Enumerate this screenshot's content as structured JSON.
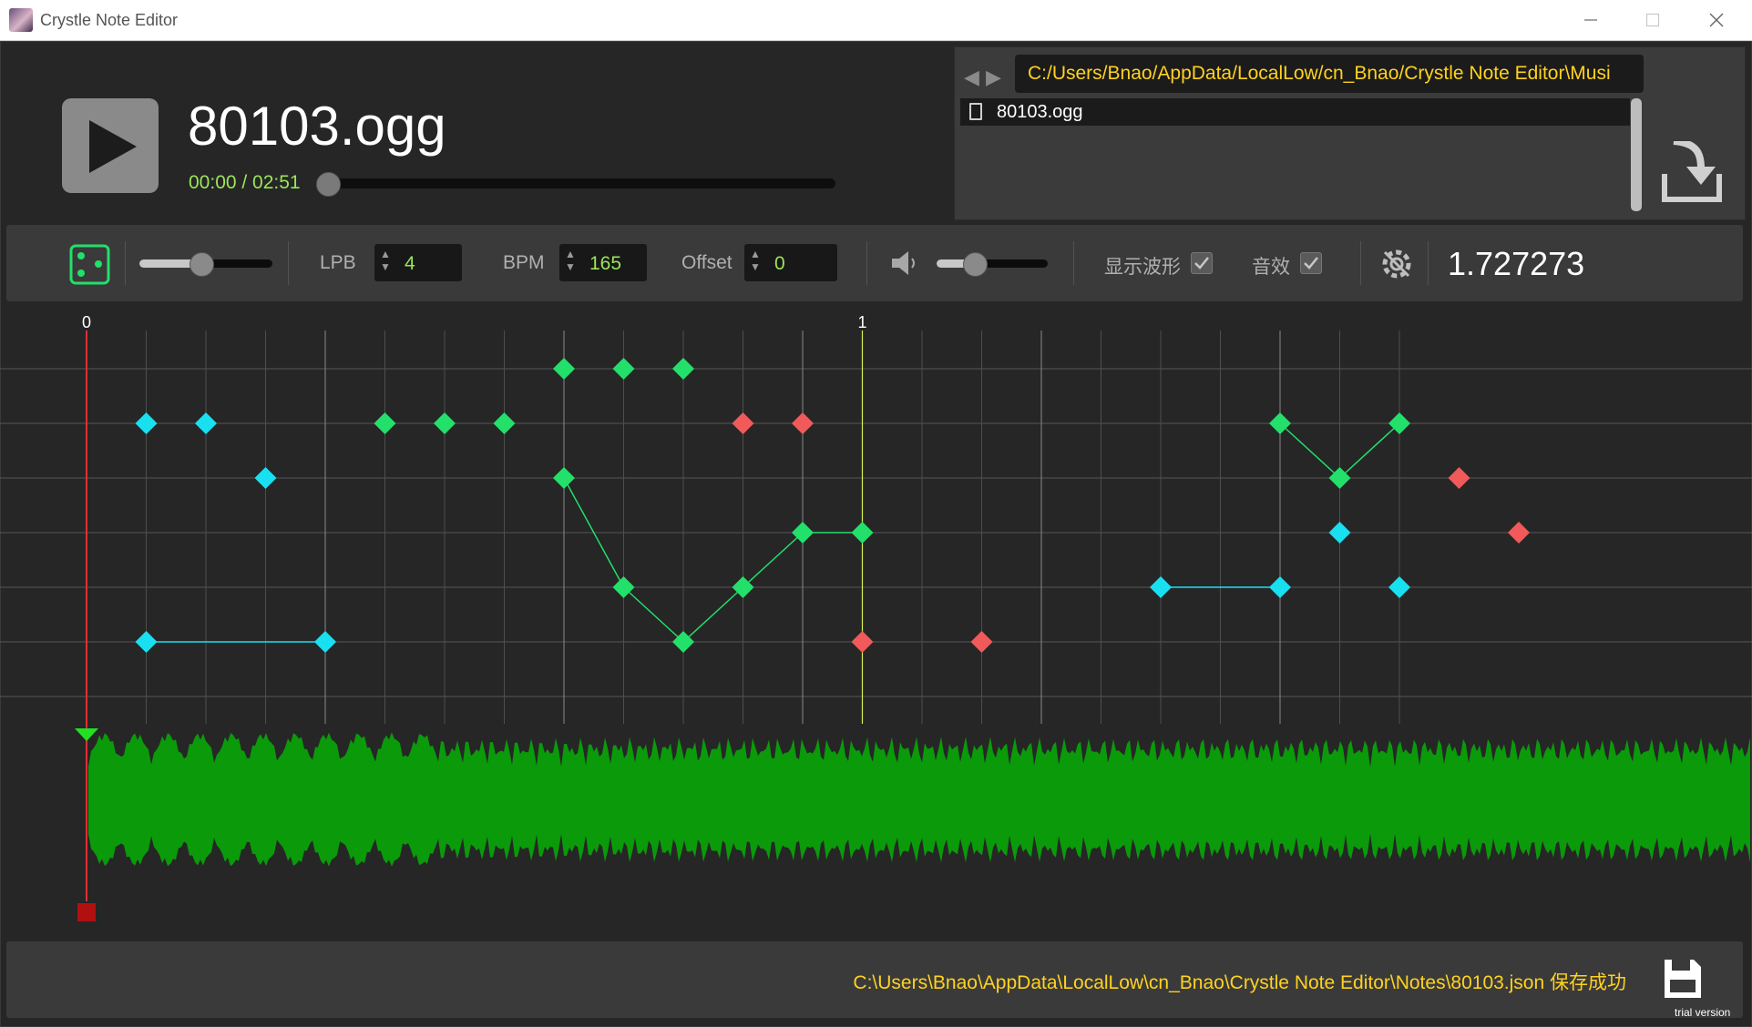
{
  "window": {
    "title": "Crystle Note Editor",
    "min_icon": "minimize-icon",
    "max_icon": "maximize-icon",
    "close_icon": "close-icon"
  },
  "player": {
    "song_title": "80103.ogg",
    "time": "00:00 / 02:51",
    "progress": 0.0,
    "play_icon": "play-icon"
  },
  "file_browser": {
    "path": "C:/Users/Bnao/AppData/LocalLow/cn_Bnao/Crystle Note Editor\\Musi",
    "files": [
      "80103.ogg"
    ],
    "import_icon": "import-icon"
  },
  "toolbar": {
    "dice_icon": "dice-icon",
    "zoom_level": 0.5,
    "lpb_label": "LPB",
    "lpb_value": "4",
    "bpm_label": "BPM",
    "bpm_value": "165",
    "offset_label": "Offset",
    "offset_value": "0",
    "volume_icon": "speaker-icon",
    "volume_level": 0.3,
    "waveform_label": "显示波形",
    "waveform_checked": true,
    "sfx_label": "音效",
    "sfx_checked": true,
    "settings_icon": "settings-icon",
    "value": "1.727273"
  },
  "editor": {
    "measure_labels": [
      "0",
      "1"
    ],
    "colors": {
      "cyan": "#18e0f0",
      "green": "#22e06a",
      "red": "#f05a5a",
      "waveform": "#0a9a0a",
      "playhead": "#e03030",
      "measure_line": "#d8f050"
    }
  },
  "status": {
    "message": "C:\\Users\\Bnao\\AppData\\LocalLow\\cn_Bnao\\Crystle Note Editor\\Notes\\80103.json 保存成功",
    "save_icon": "save-icon"
  },
  "watermark": "trial version"
}
